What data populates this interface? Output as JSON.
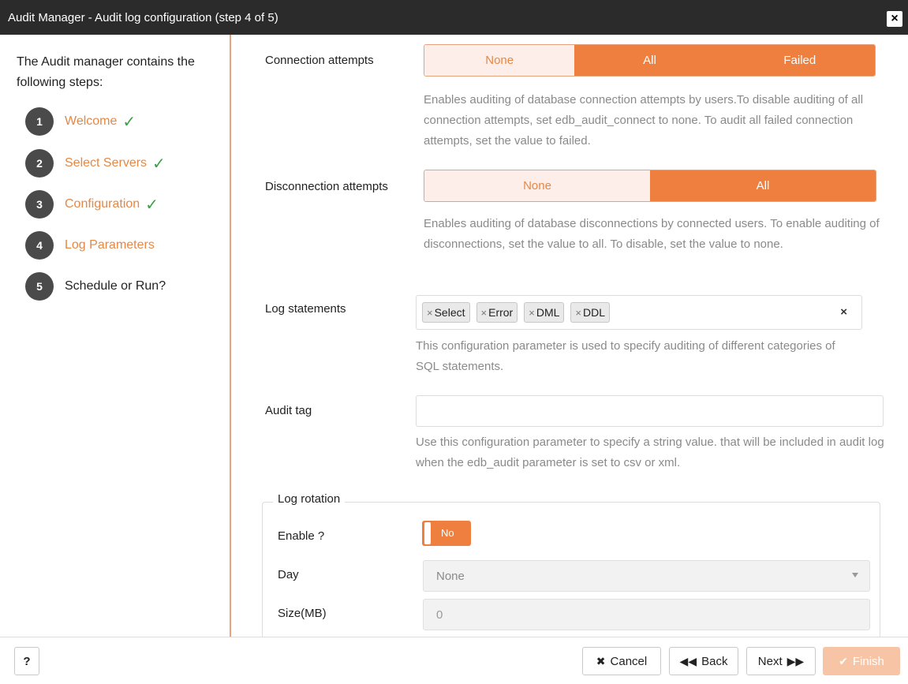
{
  "window": {
    "title": "Audit Manager - Audit log configuration (step 4 of 5)",
    "close_icon": "×"
  },
  "sidebar": {
    "intro": "The Audit manager contains the following steps:",
    "steps": [
      {
        "num": "1",
        "label": "Welcome",
        "done": "✓"
      },
      {
        "num": "2",
        "label": "Select Servers",
        "done": "✓"
      },
      {
        "num": "3",
        "label": "Configuration",
        "done": "✓"
      },
      {
        "num": "4",
        "label": "Log Parameters"
      },
      {
        "num": "5",
        "label": "Schedule or Run?"
      }
    ]
  },
  "connection": {
    "label": "Connection attempts",
    "options": [
      "None",
      "All",
      "Failed"
    ],
    "selected": [
      "All",
      "Failed"
    ],
    "help": "Enables auditing of database connection attempts by users.To disable auditing of all connection attempts, set edb_audit_connect to none. To audit all failed connection attempts, set the value to failed."
  },
  "disconnection": {
    "label": "Disconnection attempts",
    "options": [
      "None",
      "All"
    ],
    "selected": [
      "All"
    ],
    "help": "Enables auditing of database disconnections by connected users. To enable auditing of disconnections, set the value to all. To disable, set the value to none."
  },
  "log_statements": {
    "label": "Log statements",
    "tags": [
      "Select",
      "Error",
      "DML",
      "DDL"
    ],
    "tag_remove": "×",
    "clear": "×",
    "help": "This configuration parameter is used to specify auditing of different categories of SQL statements."
  },
  "audit_tag": {
    "label": "Audit tag",
    "value": "",
    "help": "Use this configuration parameter to specify a string value. that will be included in audit log when the edb_audit parameter is set to csv or xml."
  },
  "log_rotation": {
    "legend": "Log rotation",
    "enable_label": "Enable ?",
    "enable_value": "No",
    "day_label": "Day",
    "day_value": "None",
    "size_label": "Size(MB)",
    "size_value": "0"
  },
  "footer": {
    "help": "?",
    "cancel": "Cancel",
    "back": "Back",
    "next": "Next",
    "finish": "Finish"
  },
  "colors": {
    "accent": "#ee7f3e",
    "accent_light": "#fdeee9",
    "done": "#3aa14a",
    "titlebar": "#2b2b2b"
  }
}
